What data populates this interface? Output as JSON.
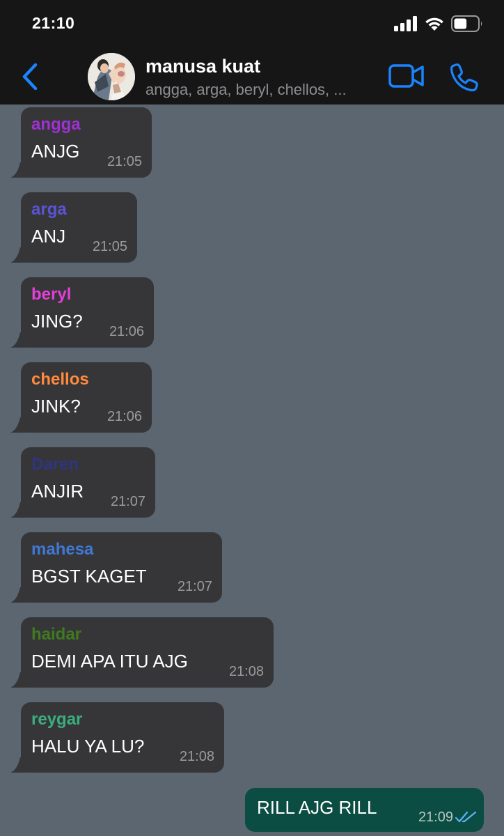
{
  "status_bar": {
    "time": "21:10",
    "icons": [
      "cellular-signal-icon",
      "wifi-icon",
      "battery-icon"
    ],
    "battery_level": 0.55
  },
  "header": {
    "back_icon": "chevron-left-icon",
    "title": "manusa kuat",
    "subtitle": "angga, arga, beryl, chellos, ...",
    "actions": [
      "video-call-icon",
      "phone-icon"
    ],
    "accent_color": "#1a84ff"
  },
  "messages": [
    {
      "sender": "angga",
      "sender_color": "#a12fd6",
      "text": "ANJG",
      "time": "21:05"
    },
    {
      "sender": "arga",
      "sender_color": "#5b55d6",
      "text": "ANJ",
      "time": "21:05"
    },
    {
      "sender": "beryl",
      "sender_color": "#e33fd9",
      "text": "JING?",
      "time": "21:06"
    },
    {
      "sender": "chellos",
      "sender_color": "#ff8a3d",
      "text": "JINK?",
      "time": "21:06"
    },
    {
      "sender": "Daren",
      "sender_color": "#2f3580",
      "text": "ANJIR",
      "time": "21:07"
    },
    {
      "sender": "mahesa",
      "sender_color": "#3f78d6",
      "text": "BGST KAGET",
      "time": "21:07"
    },
    {
      "sender": "haidar",
      "sender_color": "#3f7a1f",
      "text": "DEMI APA ITU AJG",
      "time": "21:08"
    },
    {
      "sender": "reygar",
      "sender_color": "#3aae7e",
      "text": "HALU YA LU?",
      "time": "21:08"
    }
  ],
  "outgoing": {
    "text": "RILL AJG RILL",
    "time": "21:09",
    "status_icon": "double-check-icon",
    "status_color": "#5ab4f5"
  },
  "colors": {
    "chat_background": "#5c6670",
    "incoming_bubble": "#363638",
    "outgoing_bubble": "#0b4d43",
    "header_background": "#161616"
  }
}
